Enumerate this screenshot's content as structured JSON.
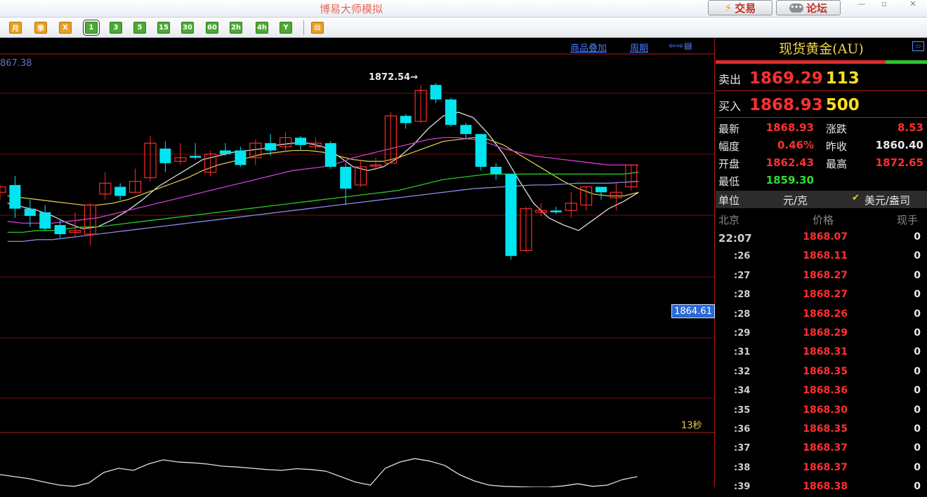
{
  "window": {
    "title": "博易大师模拟",
    "trade_label": "交易",
    "forum_label": "论坛",
    "min_glyph": "—",
    "restore_glyph": "▫",
    "close_glyph": "✕"
  },
  "toolbar": {
    "buttons": [
      {
        "label": "月",
        "style": "o"
      },
      {
        "label": "季",
        "style": "o"
      },
      {
        "label": "X",
        "style": "o"
      },
      {
        "label": "1",
        "style": "g",
        "selected": true
      },
      {
        "label": "3",
        "style": "g"
      },
      {
        "label": "5",
        "style": "g"
      },
      {
        "label": "15",
        "style": "g"
      },
      {
        "label": "30",
        "style": "g"
      },
      {
        "label": "60",
        "style": "g"
      },
      {
        "label": "2h",
        "style": "g"
      },
      {
        "label": "4h",
        "style": "g"
      },
      {
        "label": "Y",
        "style": "g"
      }
    ],
    "table_icon": "table-icon"
  },
  "chart": {
    "overlay_link": "商品叠加",
    "period_link": "周期",
    "layout_icons": "⇦⇨▤",
    "top_left_value": "867.38",
    "high_annotation": "1872.54→",
    "current_price_label": "1864.61",
    "countdown": "13秒",
    "colors": {
      "up": "#ff2a2a",
      "down": "#00e5f0",
      "ma1": "#dcdcdc",
      "ma2": "#d8c840",
      "ma3": "#d23cd2",
      "ma4": "#28c828",
      "ma5": "#8a8ae8",
      "grid": "#6e1010"
    }
  },
  "chart_data": {
    "type": "candlestick",
    "y_range": [
      1858.6,
      1874.2
    ],
    "candles": [
      {
        "o": 1866.6,
        "c": 1866.9,
        "h": 1867.0,
        "l": 1866.2
      },
      {
        "o": 1867.0,
        "c": 1865.7,
        "h": 1867.5,
        "l": 1865.2
      },
      {
        "o": 1865.7,
        "c": 1865.3,
        "h": 1866.2,
        "l": 1864.7
      },
      {
        "o": 1865.5,
        "c": 1864.6,
        "h": 1865.9,
        "l": 1864.5
      },
      {
        "o": 1864.8,
        "c": 1864.3,
        "h": 1865.1,
        "l": 1864.1
      },
      {
        "o": 1864.4,
        "c": 1864.5,
        "h": 1865.5,
        "l": 1864.1
      },
      {
        "o": 1864.3,
        "c": 1865.9,
        "h": 1866.0,
        "l": 1863.7
      },
      {
        "o": 1866.5,
        "c": 1867.1,
        "h": 1867.7,
        "l": 1866.2
      },
      {
        "o": 1866.9,
        "c": 1866.4,
        "h": 1867.1,
        "l": 1866.2
      },
      {
        "o": 1866.6,
        "c": 1867.2,
        "h": 1867.9,
        "l": 1866.6
      },
      {
        "o": 1867.4,
        "c": 1869.3,
        "h": 1869.7,
        "l": 1867.2
      },
      {
        "o": 1869.0,
        "c": 1868.2,
        "h": 1869.4,
        "l": 1867.7
      },
      {
        "o": 1868.3,
        "c": 1868.5,
        "h": 1869.3,
        "l": 1868.1
      },
      {
        "o": 1868.6,
        "c": 1868.5,
        "h": 1869.3,
        "l": 1868.4
      },
      {
        "o": 1867.7,
        "c": 1868.7,
        "h": 1868.9,
        "l": 1867.5
      },
      {
        "o": 1868.9,
        "c": 1868.7,
        "h": 1869.3,
        "l": 1868.6
      },
      {
        "o": 1868.9,
        "c": 1868.1,
        "h": 1869.1,
        "l": 1868.0
      },
      {
        "o": 1868.5,
        "c": 1869.3,
        "h": 1869.5,
        "l": 1868.1
      },
      {
        "o": 1869.3,
        "c": 1868.9,
        "h": 1869.8,
        "l": 1868.6
      },
      {
        "o": 1869.1,
        "c": 1869.6,
        "h": 1869.9,
        "l": 1868.8
      },
      {
        "o": 1869.6,
        "c": 1869.2,
        "h": 1869.7,
        "l": 1868.9
      },
      {
        "o": 1869.1,
        "c": 1869.3,
        "h": 1869.6,
        "l": 1868.9
      },
      {
        "o": 1869.3,
        "c": 1868.0,
        "h": 1869.4,
        "l": 1867.9
      },
      {
        "o": 1868.0,
        "c": 1866.8,
        "h": 1868.2,
        "l": 1865.9
      },
      {
        "o": 1867.0,
        "c": 1868.0,
        "h": 1868.3,
        "l": 1866.9
      },
      {
        "o": 1868.1,
        "c": 1868.1,
        "h": 1868.5,
        "l": 1867.8
      },
      {
        "o": 1868.2,
        "c": 1870.8,
        "h": 1871.0,
        "l": 1868.2
      },
      {
        "o": 1870.8,
        "c": 1870.4,
        "h": 1870.9,
        "l": 1870.1
      },
      {
        "o": 1870.5,
        "c": 1872.2,
        "h": 1872.5,
        "l": 1870.4
      },
      {
        "o": 1872.5,
        "c": 1871.7,
        "h": 1872.6,
        "l": 1871.5
      },
      {
        "o": 1871.7,
        "c": 1870.3,
        "h": 1871.8,
        "l": 1870.2
      },
      {
        "o": 1870.3,
        "c": 1869.8,
        "h": 1870.4,
        "l": 1869.5
      },
      {
        "o": 1869.8,
        "c": 1868.0,
        "h": 1869.8,
        "l": 1867.8
      },
      {
        "o": 1868.0,
        "c": 1867.6,
        "h": 1868.2,
        "l": 1867.3
      },
      {
        "o": 1867.6,
        "c": 1863.1,
        "h": 1867.6,
        "l": 1862.9
      },
      {
        "o": 1863.4,
        "c": 1865.7,
        "h": 1865.8,
        "l": 1863.3
      },
      {
        "o": 1865.5,
        "c": 1865.6,
        "h": 1866.0,
        "l": 1865.3
      },
      {
        "o": 1865.6,
        "c": 1865.5,
        "h": 1865.8,
        "l": 1865.4
      },
      {
        "o": 1865.6,
        "c": 1866.0,
        "h": 1866.6,
        "l": 1865.2
      },
      {
        "o": 1865.9,
        "c": 1866.9,
        "h": 1866.9,
        "l": 1865.6
      },
      {
        "o": 1866.9,
        "c": 1866.6,
        "h": 1866.9,
        "l": 1866.2
      },
      {
        "o": 1866.3,
        "c": 1866.6,
        "h": 1867.1,
        "l": 1865.6
      },
      {
        "o": 1866.9,
        "c": 1868.1,
        "h": 1868.1,
        "l": 1866.7
      }
    ],
    "ma": [
      {
        "name": "ma1",
        "values": [
          1866.0,
          1865.8,
          1865.6,
          1865.3,
          1864.9,
          1864.6,
          1864.7,
          1865.1,
          1865.6,
          1866.2,
          1866.9,
          1867.4,
          1867.9,
          1868.4,
          1868.6,
          1868.8,
          1868.9,
          1869.0,
          1869.2,
          1869.3,
          1869.3,
          1869.1,
          1868.6,
          1868.0,
          1867.8,
          1868.0,
          1868.5,
          1869.2,
          1870.1,
          1870.8,
          1871.0,
          1870.7,
          1869.8,
          1868.7,
          1867.3,
          1866.0,
          1865.2,
          1864.8,
          1864.5,
          1865.1,
          1865.7,
          1866.1,
          1866.6
        ]
      },
      {
        "name": "ma2",
        "values": [
          1866.4,
          1866.3,
          1866.2,
          1866.1,
          1866.0,
          1865.9,
          1865.9,
          1866.0,
          1866.2,
          1866.5,
          1866.8,
          1867.1,
          1867.4,
          1867.8,
          1868.1,
          1868.3,
          1868.5,
          1868.7,
          1868.8,
          1868.9,
          1868.9,
          1868.8,
          1868.6,
          1868.4,
          1868.3,
          1868.3,
          1868.5,
          1868.8,
          1869.1,
          1869.4,
          1869.5,
          1869.6,
          1869.5,
          1869.2,
          1868.7,
          1868.2,
          1867.7,
          1867.2,
          1866.8,
          1866.5,
          1866.4,
          1866.4,
          1866.6
        ]
      },
      {
        "name": "ma3",
        "values": [
          1865.0,
          1864.9,
          1864.9,
          1864.9,
          1865.0,
          1865.1,
          1865.2,
          1865.4,
          1865.6,
          1865.8,
          1866.0,
          1866.2,
          1866.4,
          1866.6,
          1866.8,
          1867.0,
          1867.2,
          1867.4,
          1867.6,
          1867.8,
          1867.9,
          1868.0,
          1868.2,
          1868.5,
          1868.7,
          1868.9,
          1869.1,
          1869.3,
          1869.5,
          1869.6,
          1869.6,
          1869.5,
          1869.3,
          1869.0,
          1868.8,
          1868.6,
          1868.5,
          1868.4,
          1868.3,
          1868.2,
          1868.1,
          1868.1,
          1868.1
        ]
      },
      {
        "name": "ma4",
        "values": [
          1864.4,
          1864.4,
          1864.5,
          1864.5,
          1864.6,
          1864.7,
          1864.7,
          1864.8,
          1864.9,
          1865.0,
          1865.1,
          1865.2,
          1865.3,
          1865.4,
          1865.5,
          1865.6,
          1865.7,
          1865.8,
          1865.9,
          1866.0,
          1866.1,
          1866.2,
          1866.3,
          1866.4,
          1866.5,
          1866.6,
          1866.7,
          1866.9,
          1867.1,
          1867.3,
          1867.4,
          1867.5,
          1867.6,
          1867.6,
          1867.6,
          1867.6,
          1867.6,
          1867.6,
          1867.6,
          1867.6,
          1867.6,
          1867.6,
          1867.7
        ]
      },
      {
        "name": "ma5",
        "values": [
          1863.9,
          1863.9,
          1864.0,
          1864.0,
          1864.1,
          1864.2,
          1864.3,
          1864.4,
          1864.5,
          1864.6,
          1864.7,
          1864.8,
          1864.9,
          1865.0,
          1865.1,
          1865.2,
          1865.3,
          1865.4,
          1865.5,
          1865.6,
          1865.7,
          1865.8,
          1865.9,
          1866.0,
          1866.1,
          1866.2,
          1866.3,
          1866.4,
          1866.5,
          1866.6,
          1866.7,
          1866.8,
          1866.85,
          1866.9,
          1866.95,
          1867.0,
          1867.0,
          1867.05,
          1867.1,
          1867.1,
          1867.1,
          1867.15,
          1867.2
        ]
      }
    ],
    "indicator": {
      "y_range": [
        0,
        100
      ],
      "values": [
        30,
        25,
        20,
        12,
        5,
        2,
        10,
        35,
        45,
        40,
        55,
        65,
        60,
        58,
        55,
        50,
        48,
        45,
        42,
        40,
        44,
        42,
        38,
        25,
        12,
        5,
        45,
        60,
        68,
        62,
        52,
        30,
        15,
        5,
        2,
        1,
        0,
        0,
        3,
        8,
        2,
        5,
        18,
        25
      ]
    }
  },
  "panel": {
    "title": "现货黄金(AU)",
    "icon": "window-icon",
    "bid_ratio": 0.805,
    "sell": {
      "label": "卖出",
      "price": "1869.29",
      "vol": "113"
    },
    "buy": {
      "label": "买入",
      "price": "1868.93",
      "vol": "500"
    },
    "stats": [
      {
        "l1": "最新",
        "v1": "1868.93",
        "c1": "#ff3030",
        "l2": "涨跌",
        "v2": "8.53",
        "c2": "#ff3030"
      },
      {
        "l1": "幅度",
        "v1": "0.46%",
        "c1": "#ff3030",
        "l2": "昨收",
        "v2": "1860.40",
        "c2": "#e8e8e8"
      },
      {
        "l1": "开盘",
        "v1": "1862.43",
        "c1": "#ff3030",
        "l2": "最高",
        "v2": "1872.65",
        "c2": "#ff3030"
      },
      {
        "l1": "最低",
        "v1": "1859.30",
        "c1": "#33dd33",
        "l2": "",
        "v2": "",
        "c2": "#e8e8e8"
      }
    ],
    "unit_label": "单位",
    "unit_value": "元/克",
    "check_mark": "✔",
    "unit_alt": "美元/盎司",
    "ticks_head": {
      "time": "北京",
      "price": "价格",
      "vol": "现手"
    },
    "ticks": [
      {
        "time": "22:07",
        "price": "1868.07",
        "vol": "0"
      },
      {
        "time": ":26",
        "price": "1868.11",
        "vol": "0"
      },
      {
        "time": ":27",
        "price": "1868.27",
        "vol": "0"
      },
      {
        "time": ":28",
        "price": "1868.27",
        "vol": "0"
      },
      {
        "time": ":28",
        "price": "1868.26",
        "vol": "0"
      },
      {
        "time": ":29",
        "price": "1868.29",
        "vol": "0"
      },
      {
        "time": ":31",
        "price": "1868.31",
        "vol": "0"
      },
      {
        "time": ":32",
        "price": "1868.35",
        "vol": "0"
      },
      {
        "time": ":34",
        "price": "1868.36",
        "vol": "0"
      },
      {
        "time": ":35",
        "price": "1868.30",
        "vol": "0"
      },
      {
        "time": ":36",
        "price": "1868.35",
        "vol": "0"
      },
      {
        "time": ":37",
        "price": "1868.37",
        "vol": "0"
      },
      {
        "time": ":38",
        "price": "1868.37",
        "vol": "0"
      },
      {
        "time": ":39",
        "price": "1868.38",
        "vol": "0"
      }
    ]
  }
}
